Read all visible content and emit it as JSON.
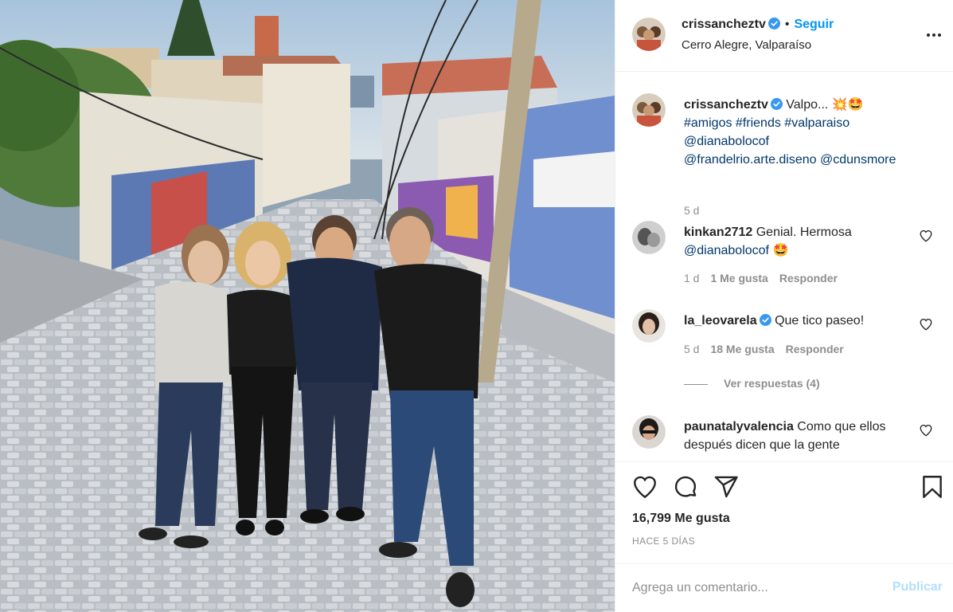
{
  "post": {
    "author": "crissancheztv",
    "follow_label": "Seguir",
    "location": "Cerro Alegre, Valparaíso",
    "caption": {
      "text": "Valpo...",
      "emojis": "💥🤩",
      "hashtags": "#amigos #friends #valparaiso",
      "mention_1": "@dianabolocof",
      "mention_2": "@frandelrio.arte.diseno",
      "mention_3": "@cdunsmore",
      "time": "5 d"
    }
  },
  "comments": [
    {
      "username": "kinkan2712",
      "text": "Genial. Hermosa",
      "mention": "@dianabolocof",
      "emoji": "🤩",
      "time": "1 d",
      "likes": "1 Me gusta",
      "reply": "Responder"
    },
    {
      "username": "la_leovarela",
      "text": "Que tico paseo!",
      "time": "5 d",
      "likes": "18 Me gusta",
      "reply": "Responder",
      "view_replies": "Ver respuestas (4)"
    },
    {
      "username": "paunatalyvalencia",
      "text": "Como que ellos después dicen que la gente"
    }
  ],
  "actions": {
    "likes_count": "16,799 Me gusta",
    "posted_ago": "HACE 5 DÍAS"
  },
  "composer": {
    "placeholder": "Agrega un comentario...",
    "publish_label": "Publicar"
  },
  "colors": {
    "link": "#00376b",
    "accent": "#0095f6",
    "muted": "#8e8e8e",
    "publish_disabled": "#b2dffc"
  }
}
